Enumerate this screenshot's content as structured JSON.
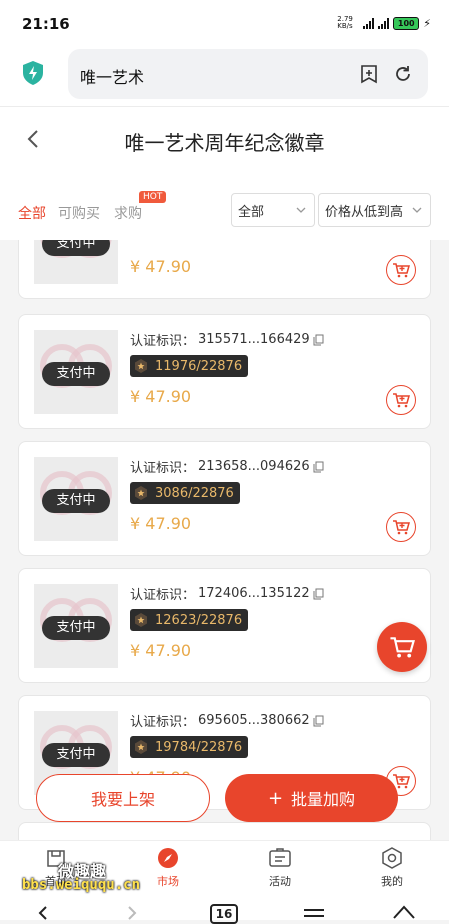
{
  "status": {
    "time": "21:16",
    "net_speed": "2.79 KB/s",
    "battery": "100"
  },
  "browser": {
    "url_text": "唯一艺术"
  },
  "page": {
    "title": "唯一艺术周年纪念徽章"
  },
  "filters": {
    "tabs": [
      "全部",
      "可购买",
      "求购"
    ],
    "hot_badge": "HOT",
    "category_select": "全部",
    "sort_select": "价格从低到高"
  },
  "items": [
    {
      "cert_label": "",
      "cert_id": "",
      "serial": "",
      "price": "¥ 47.90",
      "status": "支付中"
    },
    {
      "cert_label": "认证标识：",
      "cert_id": "315571...166429",
      "serial": "11976/22876",
      "price": "¥ 47.90",
      "status": "支付中"
    },
    {
      "cert_label": "认证标识：",
      "cert_id": "213658...094626",
      "serial": "3086/22876",
      "price": "¥ 47.90",
      "status": "支付中"
    },
    {
      "cert_label": "认证标识：",
      "cert_id": "172406...135122",
      "serial": "12623/22876",
      "price": "¥ 47.90",
      "status": "支付中"
    },
    {
      "cert_label": "认证标识：",
      "cert_id": "695605...380662",
      "serial": "19784/22876",
      "price": "¥ 47.90",
      "status": "支付中"
    }
  ],
  "actions": {
    "sell": "我要上架",
    "batch_plus": "+",
    "batch_buy": "批量加购"
  },
  "nav": {
    "home": "首页",
    "market": "市场",
    "activity": "活动",
    "mine": "我的"
  },
  "watermark": {
    "name": "微趣趣",
    "url": "bbs.weiququ.cn"
  },
  "system": {
    "tab_count": "16"
  },
  "colors": {
    "accent": "#e8452c",
    "price": "#e8a94a",
    "serial_text": "#e8b86a"
  }
}
